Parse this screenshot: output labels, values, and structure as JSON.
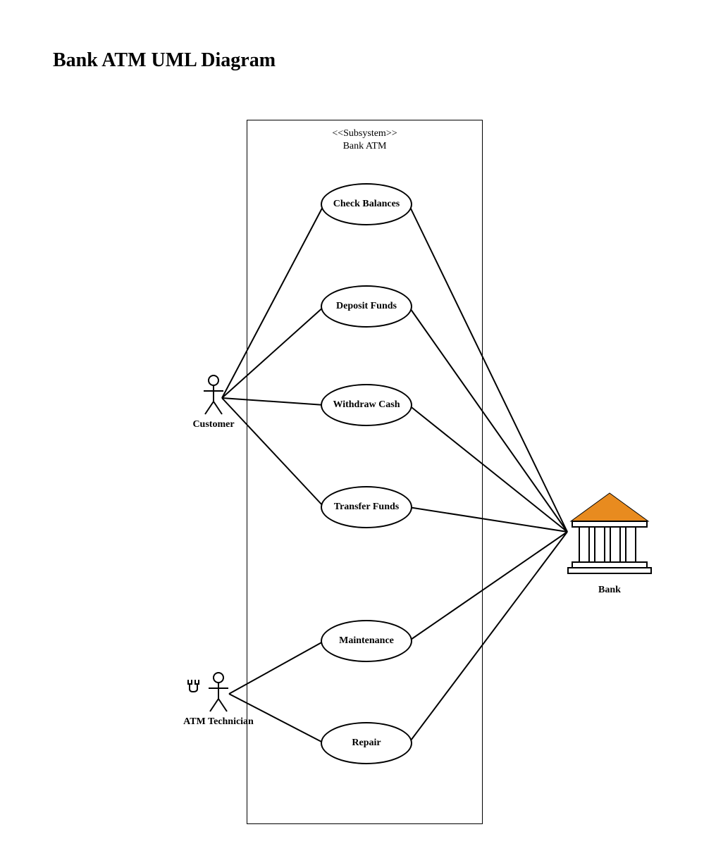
{
  "title": "Bank ATM UML Diagram",
  "subsystem": {
    "stereotype": "<<Subsystem>>",
    "name": "Bank ATM"
  },
  "actors": {
    "customer": "Customer",
    "technician": "ATM Technician",
    "bank": "Bank"
  },
  "usecases": {
    "check_balances": "Check Balances",
    "deposit_funds": "Deposit Funds",
    "withdraw_cash": "Withdraw Cash",
    "transfer_funds": "Transfer Funds",
    "maintenance": "Maintenance",
    "repair": "Repair"
  }
}
